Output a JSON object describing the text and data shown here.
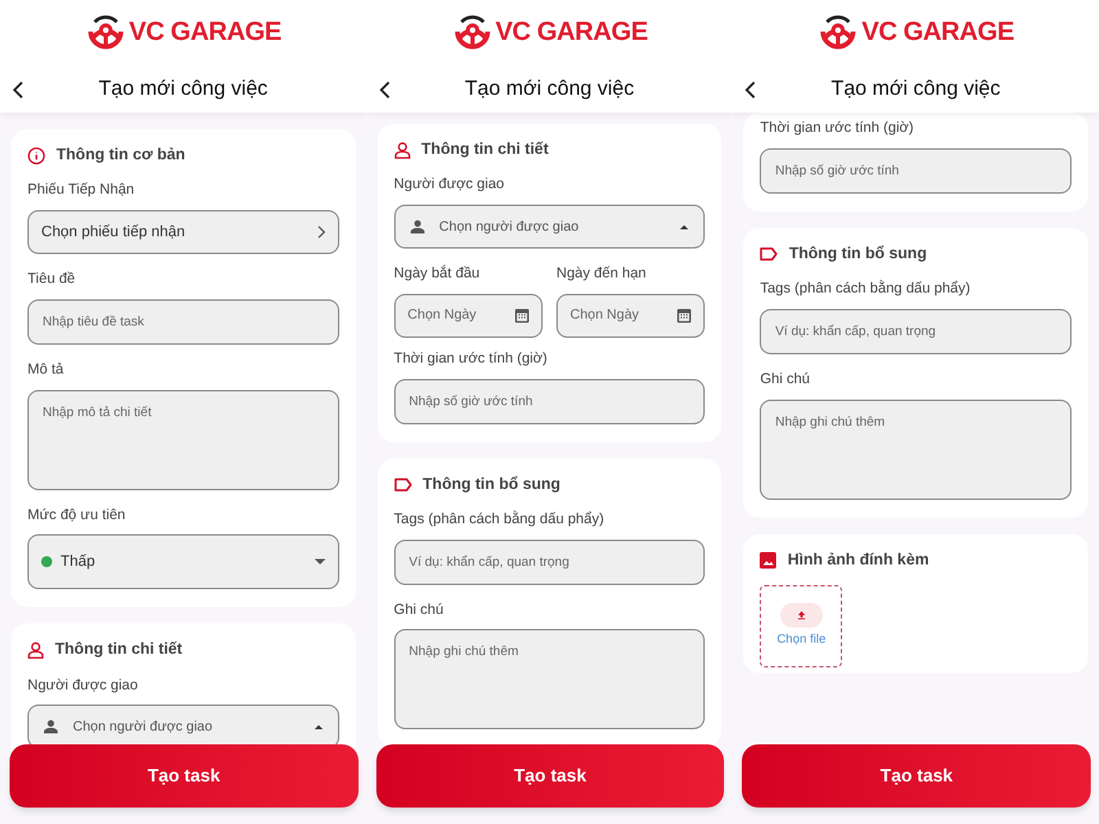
{
  "screens": [
    {
      "brand": "VC GARAGE",
      "title": "Tạo mới công việc",
      "sections": [
        {
          "kind": "basic",
          "title": "Thông tin cơ bản",
          "fields": [
            {
              "kind": "picker",
              "label": "Phiếu Tiếp Nhận",
              "value": "Chọn phiếu tiếp nhận"
            },
            {
              "kind": "text",
              "label": "Tiêu đề",
              "placeholder": "Nhập tiêu đề task"
            },
            {
              "kind": "textarea",
              "label": "Mô tả",
              "placeholder": "Nhập mô tả chi tiết"
            },
            {
              "kind": "priority",
              "label": "Mức độ ưu tiên",
              "value": "Thấp",
              "color": "#34a853"
            }
          ]
        },
        {
          "kind": "detail",
          "title": "Thông tin chi tiết",
          "fields": [
            {
              "kind": "person",
              "label": "Người được giao",
              "placeholder": "Chọn người được giao"
            }
          ]
        }
      ],
      "button": "Tạo task"
    },
    {
      "brand": "VC GARAGE",
      "title": "Tạo mới công việc",
      "sections": [
        {
          "kind": "detail",
          "title": "Thông tin chi tiết",
          "fields": [
            {
              "kind": "person",
              "label": "Người được giao",
              "placeholder": "Chọn người được giao"
            },
            {
              "kind": "dates",
              "items": [
                {
                  "label": "Ngày bắt đầu",
                  "placeholder": "Chọn Ngày"
                },
                {
                  "label": "Ngày đến hạn",
                  "placeholder": "Chọn Ngày"
                }
              ]
            },
            {
              "kind": "text",
              "label": "Thời gian ước tính (giờ)",
              "placeholder": "Nhập số giờ ước tính"
            }
          ]
        },
        {
          "kind": "extra",
          "title": "Thông tin bổ sung",
          "fields": [
            {
              "kind": "text",
              "label": "Tags (phân cách bằng dấu phẩy)",
              "placeholder": "Ví dụ: khẩn cấp, quan trọng"
            },
            {
              "kind": "textarea",
              "label": "Ghi chú",
              "placeholder": "Nhập ghi chú thêm"
            }
          ]
        }
      ],
      "button": "Tạo task"
    },
    {
      "brand": "VC GARAGE",
      "title": "Tạo mới công việc",
      "sections": [
        {
          "fields": [
            {
              "kind": "text",
              "label": "Thời gian ước tính (giờ)",
              "placeholder": "Nhập số giờ ước tính"
            }
          ]
        },
        {
          "kind": "extra",
          "title": "Thông tin bổ sung",
          "fields": [
            {
              "kind": "text",
              "label": "Tags (phân cách bằng dấu phẩy)",
              "placeholder": "Ví dụ: khẩn cấp, quan trọng"
            },
            {
              "kind": "textarea",
              "label": "Ghi chú",
              "placeholder": "Nhập ghi chú thêm"
            }
          ]
        },
        {
          "kind": "attachments",
          "title": "Hình ảnh đính kèm",
          "fields": [
            {
              "kind": "upload",
              "label": "Chọn file"
            }
          ]
        }
      ],
      "button": "Tạo task"
    }
  ]
}
